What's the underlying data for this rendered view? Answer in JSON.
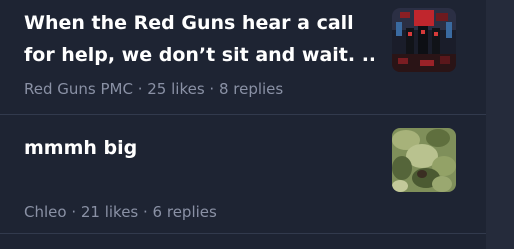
{
  "colors": {
    "background": "#1e2433",
    "title": "#ffffff",
    "meta": "#8a91a5",
    "divider": "#323a4d"
  },
  "posts": [
    {
      "title_line1": "When the Red Guns hear a call",
      "title_line2": "for help, we don’t sit and wait. ...",
      "meta": "Red Guns PMC · 25 likes · 8 replies",
      "thumbnail_icon": "dark-red-soldiers-thumbnail"
    },
    {
      "title_line1": "mmmh big",
      "meta": "Chleo · 21 likes · 6 replies",
      "thumbnail_icon": "green-camo-thumbnail"
    }
  ]
}
